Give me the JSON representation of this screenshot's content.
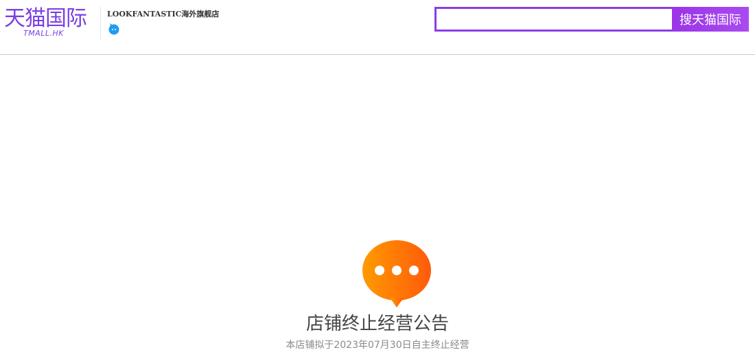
{
  "header": {
    "logo": {
      "main_text": "天猫国际",
      "sub_text": "TMALL.HK",
      "color": "#7b3fe4"
    },
    "shop_name": "LOOKFANTASTIC海外旗舰店",
    "contact_icon": "wangwang-chat-icon"
  },
  "search": {
    "value": "",
    "placeholder": "",
    "button_label": "搜天猫国际",
    "accent_color": "#8b3ce6"
  },
  "notice": {
    "icon": "chat-bubble-icon",
    "title": "店铺终止经营公告",
    "message": "本店铺拟于2023年07月30日自主终止经营",
    "icon_color_start": "#ff9a00",
    "icon_color_end": "#ff5a0a"
  }
}
